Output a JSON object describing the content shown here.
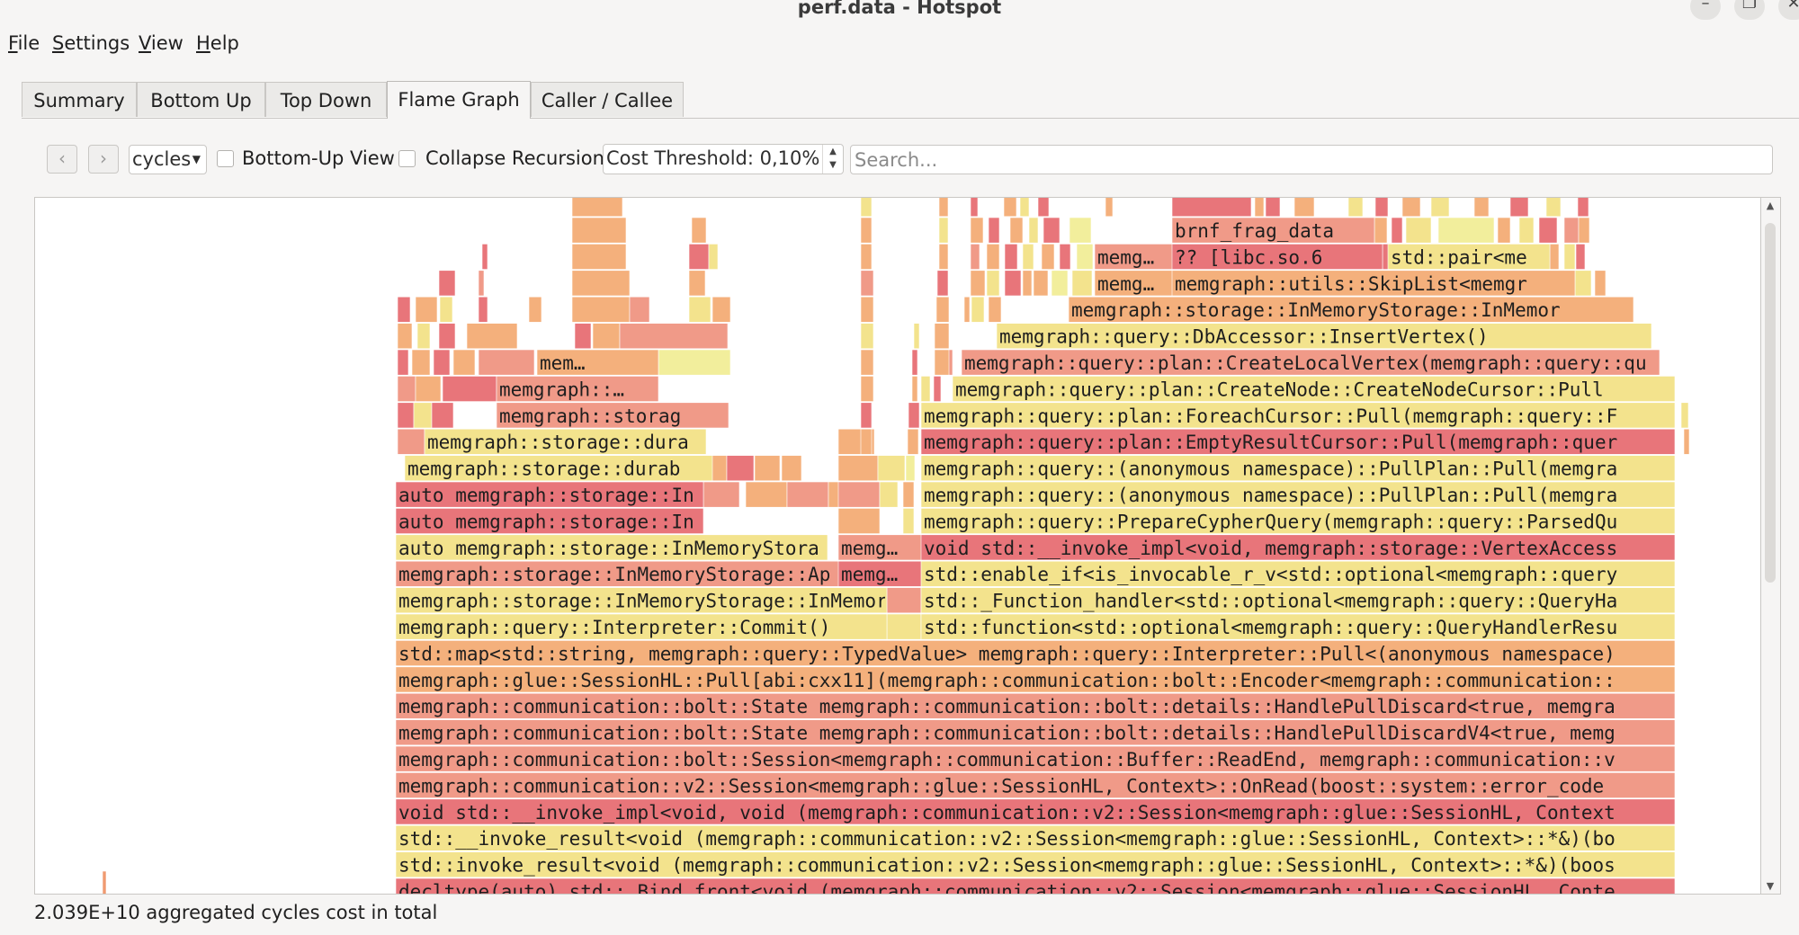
{
  "window": {
    "title": "perf.data - Hotspot",
    "minimize_glyph": "–",
    "maximize_glyph": "❐",
    "close_glyph": "✕"
  },
  "menubar": [
    {
      "label": "File",
      "mnemonic": "F"
    },
    {
      "label": "Settings",
      "mnemonic": "S"
    },
    {
      "label": "View",
      "mnemonic": "V"
    },
    {
      "label": "Help",
      "mnemonic": "H"
    }
  ],
  "tabs": [
    "Summary",
    "Bottom Up",
    "Top Down",
    "Flame Graph",
    "Caller / Callee"
  ],
  "active_tab": "Flame Graph",
  "toolbar": {
    "back_icon": "chevron-left-icon",
    "forward_icon": "chevron-right-icon",
    "cost_type": "cycles",
    "bottom_up_label": "Bottom-Up View",
    "bottom_up_checked": false,
    "collapse_label": "Collapse Recursion",
    "collapse_checked": false,
    "threshold_label": "Cost Threshold: 0,10%",
    "search_placeholder": "Search..."
  },
  "colors": {
    "red": "#e8757a",
    "salmon": "#f09a88",
    "orange": "#f4b07c",
    "yellow": "#f3e38d",
    "pale": "#f2ee9c",
    "accent": "#f09a70"
  },
  "flame_frames": [
    {
      "text": "decltype(auto) std::_Bind_front<void (memgraph::communication::v2::Session<memgraph::glue::SessionHL, Conte",
      "color": "red"
    },
    {
      "text": "std::invoke_result<void (memgraph::communication::v2::Session<memgraph::glue::SessionHL, Context>::*&)(boos",
      "color": "yellow"
    },
    {
      "text": "std::__invoke_result<void (memgraph::communication::v2::Session<memgraph::glue::SessionHL, Context>::*&)(bo",
      "color": "yellow"
    },
    {
      "text": "void std::__invoke_impl<void, void (memgraph::communication::v2::Session<memgraph::glue::SessionHL, Context",
      "color": "red"
    },
    {
      "text": "memgraph::communication::v2::Session<memgraph::glue::SessionHL, Context>::OnRead(boost::system::error_code",
      "color": "salmon"
    },
    {
      "text": "memgraph::communication::bolt::Session<memgraph::communication::Buffer::ReadEnd, memgraph::communication::v",
      "color": "salmon"
    },
    {
      "text": "memgraph::communication::bolt::State memgraph::communication::bolt::details::HandlePullDiscardV4<true, memg",
      "color": "salmon"
    },
    {
      "text": "memgraph::communication::bolt::State memgraph::communication::bolt::details::HandlePullDiscard<true, memgra",
      "color": "salmon"
    },
    {
      "text": "memgraph::glue::SessionHL::Pull[abi:cxx11](memgraph::communication::bolt::Encoder<memgraph::communication::",
      "color": "orange"
    },
    {
      "text": "std::map<std::string, memgraph::query::TypedValue> memgraph::query::Interpreter::Pull<(anonymous namespace)",
      "color": "orange"
    },
    {
      "text": "memgraph::query::Interpreter::Commit()",
      "color": "yellow"
    },
    {
      "text": "memgraph::storage::InMemoryStorage::InMemoryA",
      "color": "yellow"
    },
    {
      "text": "memgraph::storage::InMemoryStorage::Ap",
      "color": "salmon"
    },
    {
      "text": "auto memgraph::storage::InMemoryStora",
      "color": "yellow"
    },
    {
      "text": "auto memgraph::storage::In",
      "color": "red"
    },
    {
      "text": "auto memgraph::storage::In",
      "color": "red"
    },
    {
      "text": "memgraph::storage::durab",
      "color": "yellow"
    },
    {
      "text": "memgraph::storage::dura",
      "color": "yellow"
    },
    {
      "text": "memgraph::storag",
      "color": "salmon"
    },
    {
      "text": "memgraph::…",
      "color": "salmon"
    },
    {
      "text": "mem…",
      "color": "orange"
    },
    {
      "text": "memg…",
      "color": "red"
    },
    {
      "text": "memg…",
      "color": "salmon"
    },
    {
      "text": "std::function<std::optional<memgraph::query::QueryHandlerResu",
      "color": "yellow"
    },
    {
      "text": "std::_Function_handler<std::optional<memgraph::query::QueryHa",
      "color": "yellow"
    },
    {
      "text": "std::enable_if<is_invocable_r_v<std::optional<memgraph::query",
      "color": "yellow"
    },
    {
      "text": "void std::__invoke_impl<void, memgraph::storage::VertexAccess",
      "color": "red"
    },
    {
      "text": "memgraph::query::PrepareCypherQuery(memgraph::query::ParsedQu",
      "color": "yellow"
    },
    {
      "text": "memgraph::query::(anonymous namespace)::PullPlan::Pull(memgra",
      "color": "yellow"
    },
    {
      "text": "memgraph::query::(anonymous namespace)::PullPlan::Pull(memgra",
      "color": "yellow"
    },
    {
      "text": "memgraph::query::plan::EmptyResultCursor::Pull(memgraph::quer",
      "color": "red"
    },
    {
      "text": "memgraph::query::plan::ForeachCursor::Pull(memgraph::query::F",
      "color": "yellow"
    },
    {
      "text": "memgraph::query::plan::CreateNode::CreateNodeCursor::Pull",
      "color": "yellow"
    },
    {
      "text": "memgraph::query::plan::CreateLocalVertex(memgraph::query::qu",
      "color": "salmon"
    },
    {
      "text": "memgraph::query::DbAccessor::InsertVertex()",
      "color": "yellow"
    },
    {
      "text": "memgraph::storage::InMemoryStorage::InMemor",
      "color": "orange"
    },
    {
      "text": "memg…",
      "color": "orange"
    },
    {
      "text": "memgraph::utils::SkipList<memgr",
      "color": "orange"
    },
    {
      "text": "memg…",
      "color": "salmon"
    },
    {
      "text": "?? [libc.so.6",
      "color": "red"
    },
    {
      "text": "std::pair<me",
      "color": "yellow"
    },
    {
      "text": "brnf_frag_data",
      "color": "salmon"
    }
  ],
  "status": "2.039E+10 aggregated cycles cost in total"
}
